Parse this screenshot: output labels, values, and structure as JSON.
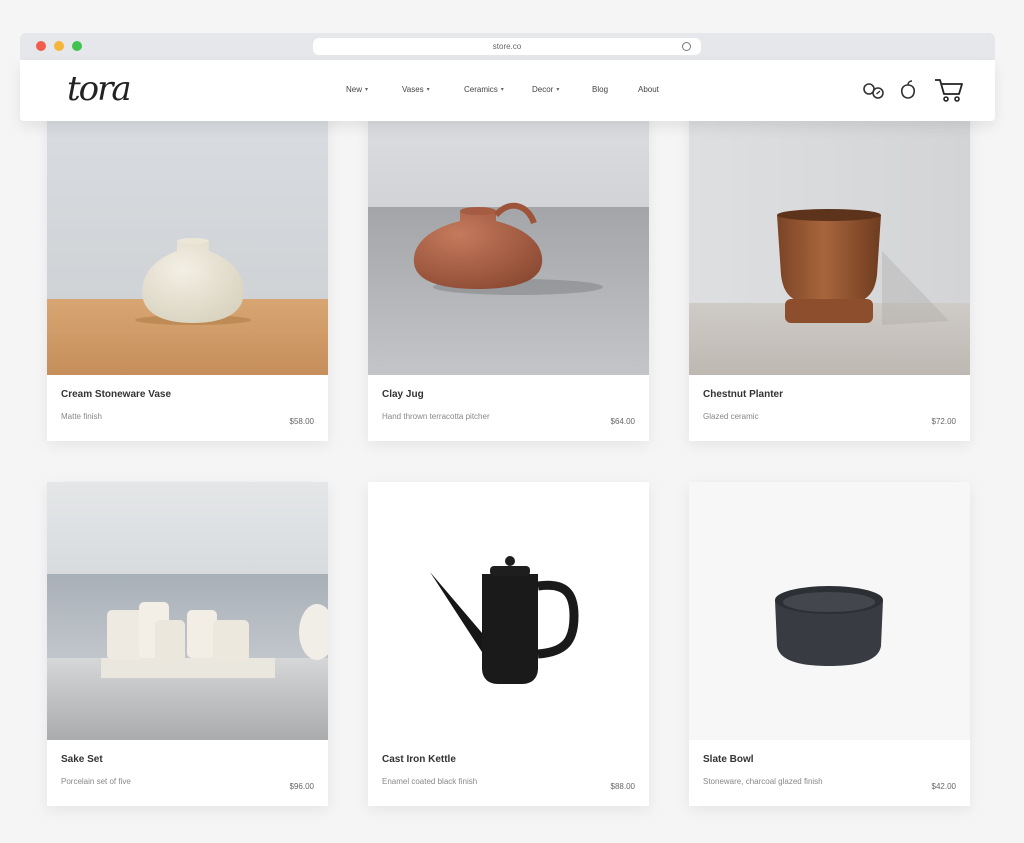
{
  "browser": {
    "url": "store.co",
    "dots": [
      "#f25c4c",
      "#f5b43a",
      "#3fc24f"
    ]
  },
  "header": {
    "logo_text": "tora",
    "nav": [
      {
        "label": "New",
        "has_dropdown": true
      },
      {
        "label": "Vases",
        "has_dropdown": true
      },
      {
        "label": "Ceramics",
        "has_dropdown": true
      },
      {
        "label": "Decor",
        "has_dropdown": true
      },
      {
        "label": "Blog",
        "has_dropdown": false
      },
      {
        "label": "About",
        "has_dropdown": false
      }
    ],
    "icons": [
      "search-icon",
      "account-icon",
      "cart-icon"
    ]
  },
  "products": [
    {
      "title": "Cream Stoneware Vase",
      "subtitle": "Matte finish",
      "price": "$58.00",
      "image": "cream-round-vase"
    },
    {
      "title": "Clay Jug",
      "subtitle": "Hand thrown terracotta pitcher",
      "price": "$64.00",
      "image": "terracotta-jug"
    },
    {
      "title": "Chestnut Planter",
      "subtitle": "Glazed ceramic",
      "price": "$72.00",
      "image": "brown-planter"
    },
    {
      "title": "Sake Set",
      "subtitle": "Porcelain set of five",
      "price": "$96.00",
      "image": "white-sake-set"
    },
    {
      "title": "Cast Iron Kettle",
      "subtitle": "Enamel coated black finish",
      "price": "$88.00",
      "image": "black-kettle"
    },
    {
      "title": "Slate Bowl",
      "subtitle": "Stoneware, charcoal glazed finish",
      "price": "$42.00",
      "image": "charcoal-bowl"
    }
  ]
}
